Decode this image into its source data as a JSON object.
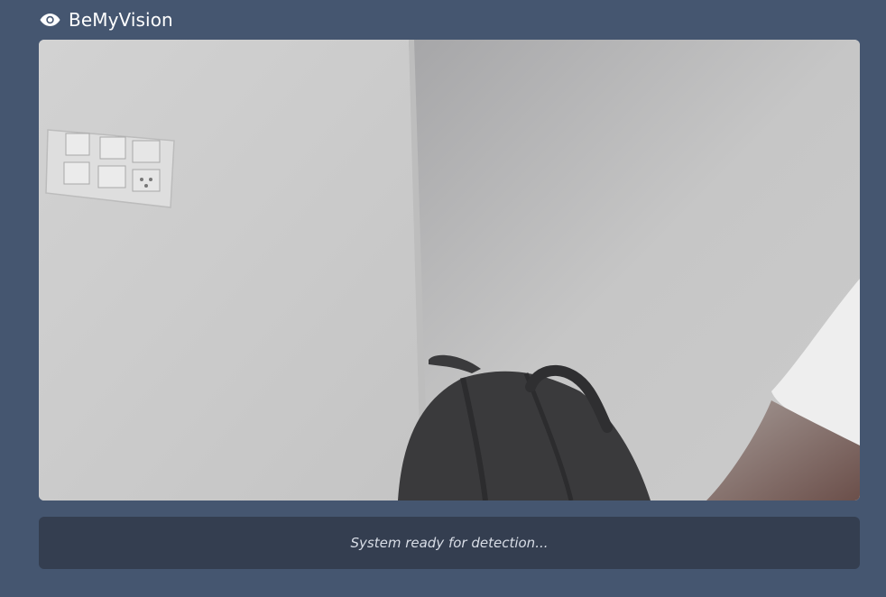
{
  "app": {
    "title": "BeMyVision",
    "logo_icon": "eye-icon",
    "accent_color": "#ffffff",
    "background_color": "#455670"
  },
  "camera_feed": {
    "icon": "webcam-frame"
  },
  "status": {
    "message": "System ready for detection..."
  }
}
